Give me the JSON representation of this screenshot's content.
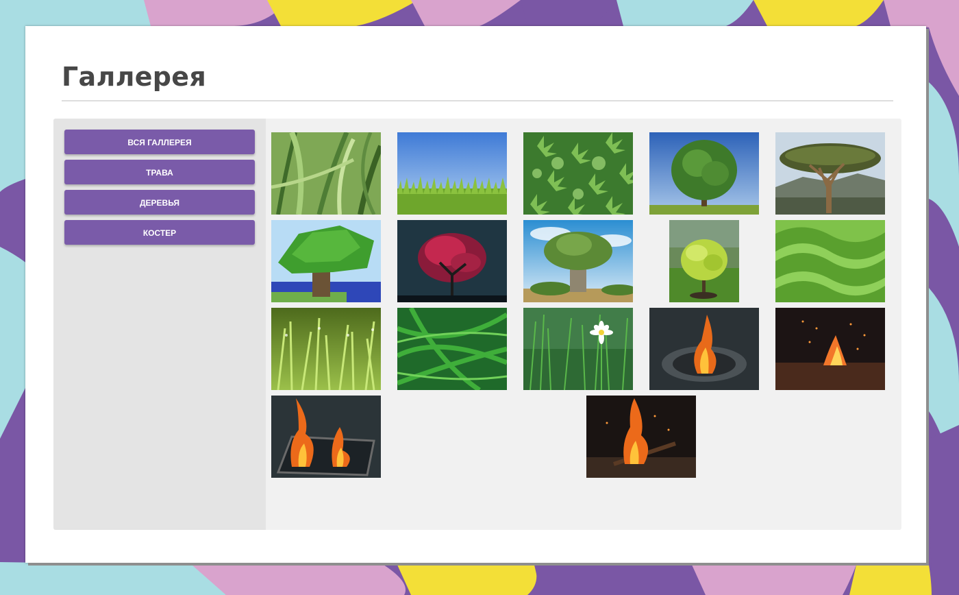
{
  "page": {
    "title": "Галлерея"
  },
  "filters": [
    {
      "label": "ВСЯ ГАЛЛЕРЕЯ"
    },
    {
      "label": "ТРАВА"
    },
    {
      "label": "ДЕРЕВЬЯ"
    },
    {
      "label": "КОСТЕР"
    }
  ],
  "colors": {
    "accent": "#7a5ba9",
    "sidebar_bg": "#e4e4e4",
    "content_bg": "#f1f1f1",
    "title": "#474747"
  },
  "gallery": [
    {
      "category": "grass",
      "subject": "grass-closeup"
    },
    {
      "category": "grass",
      "subject": "grass-blue-sky"
    },
    {
      "category": "grass",
      "subject": "leaf-pattern"
    },
    {
      "category": "trees",
      "subject": "lone-tree-field"
    },
    {
      "category": "trees",
      "subject": "dragon-tree"
    },
    {
      "category": "trees",
      "subject": "voxel-tree"
    },
    {
      "category": "trees",
      "subject": "red-blossom-tree"
    },
    {
      "category": "trees",
      "subject": "baobab-tree"
    },
    {
      "category": "trees",
      "subject": "yellow-green-bush"
    },
    {
      "category": "grass",
      "subject": "grass-waves"
    },
    {
      "category": "grass",
      "subject": "grass-dew"
    },
    {
      "category": "grass",
      "subject": "grass-blades"
    },
    {
      "category": "grass",
      "subject": "daisy-in-grass"
    },
    {
      "category": "fire",
      "subject": "campfire-pit"
    },
    {
      "category": "fire",
      "subject": "campfire-sparks"
    },
    {
      "category": "fire",
      "subject": "grill-fire"
    },
    {
      "category": "fire",
      "subject": "burning-logs"
    }
  ]
}
